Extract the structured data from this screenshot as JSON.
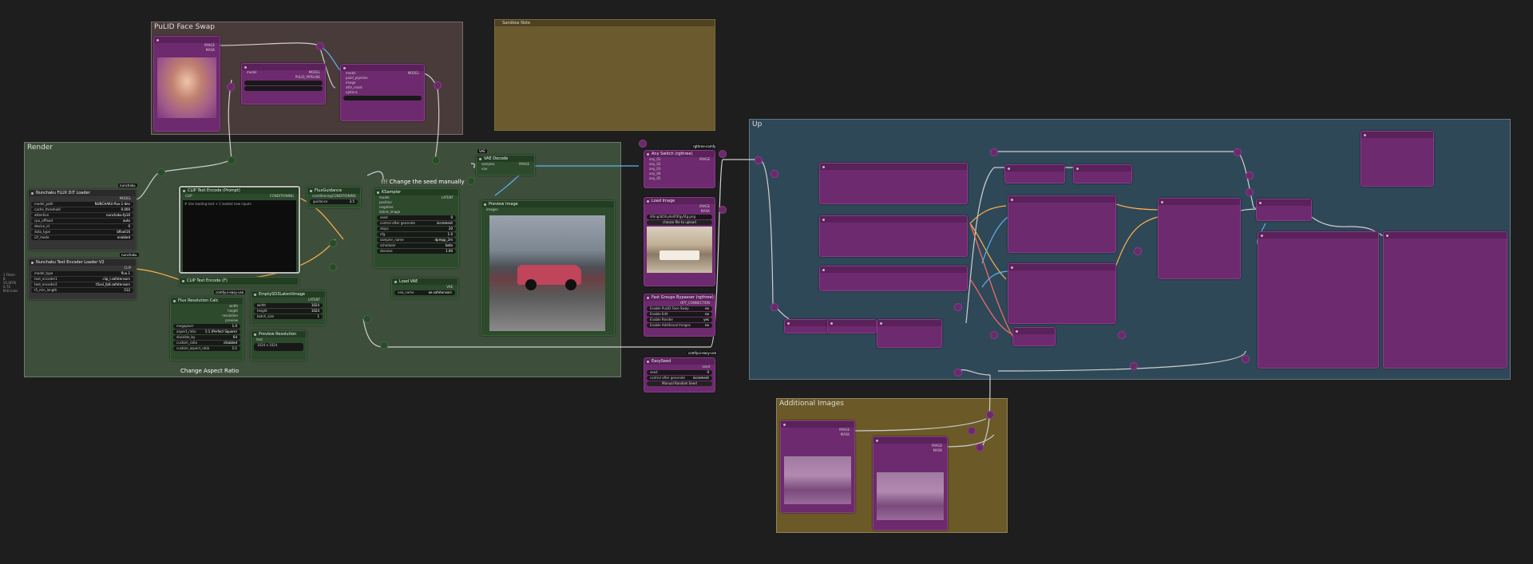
{
  "groups": {
    "pulid": "PuLID Face Swap",
    "render": "Render",
    "upscale": "Up",
    "additional": "Additional Images"
  },
  "notes": {
    "seed_manual": "!!! Change the seed manually",
    "aspect": "Change Aspect Ratio"
  },
  "nodes": {
    "sandbox_note": "Sandbox Note",
    "unet_loader": "Nunchaku FLUX DiT Loader",
    "te_loader": "Nunchaku Text Encoder Loader V2",
    "clip_prompt": "CLIP Text Encode (Prompt)",
    "clip_prompt_placeholder": "# Use loading text + 1 loaded new inputs",
    "clip_negative": "CLIP Text Encode (F)",
    "flux_guidance": "FluxGuidance",
    "ksampler": "KSampler",
    "vae_decode": "VAE Decode",
    "preview_image": "Preview Image",
    "load_vae": "Load VAE",
    "empty_latent": "EmptySD3LatentImage",
    "flux_res": "Flux Resolution Calc",
    "preview_res": "Preview Resolution",
    "any_switch": "Any Switch (rgthree)",
    "load_image": "Load Image",
    "fast_bypasser": "Fast Groups Bypasser (rgthree)",
    "easy_seed": "EasySeed",
    "choose_upload": "choose file to upload",
    "manual_seed": "Manual Random Seed",
    "image_label": "image",
    "text_label": "text"
  },
  "widgets": {
    "unet": [
      {
        "k": "model_path",
        "v": "NUNCHAKU-flux.1-dev"
      },
      {
        "k": "cache_threshold",
        "v": "0.000"
      },
      {
        "k": "attention",
        "v": "nunchaku-fp16"
      },
      {
        "k": "cpu_offload",
        "v": "auto"
      },
      {
        "k": "device_id",
        "v": "0"
      },
      {
        "k": "data_type",
        "v": "bfloat16"
      },
      {
        "k": "i2f_mode",
        "v": "enabled"
      }
    ],
    "te": [
      {
        "k": "model_type",
        "v": "flux.1"
      },
      {
        "k": "text_encoder1",
        "v": "clip_l.safetensors"
      },
      {
        "k": "text_encoder2",
        "v": "t5xxl_fp8.safetensors"
      },
      {
        "k": "t5_min_length",
        "v": "512"
      }
    ],
    "ksampler": [
      {
        "k": "seed",
        "v": "0"
      },
      {
        "k": "control after generate",
        "v": "increment"
      },
      {
        "k": "steps",
        "v": "20"
      },
      {
        "k": "cfg",
        "v": "1.0"
      },
      {
        "k": "sampler_name",
        "v": "dpmpp_2m"
      },
      {
        "k": "scheduler",
        "v": "beta"
      },
      {
        "k": "denoise",
        "v": "1.00"
      }
    ],
    "guidance": [
      {
        "k": "guidance",
        "v": "3.5"
      }
    ],
    "flux_res": [
      {
        "k": "megapixel",
        "v": "1.0"
      },
      {
        "k": "aspect_ratio",
        "v": "1:1 (Perfect Square)"
      },
      {
        "k": "divisible_by",
        "v": "64"
      },
      {
        "k": "custom_ratio",
        "v": "disabled"
      },
      {
        "k": "custom_aspect_ratio",
        "v": "1:1"
      }
    ],
    "empty_latent": [
      {
        "k": "width",
        "v": "1024"
      },
      {
        "k": "height",
        "v": "1024"
      },
      {
        "k": "batch_size",
        "v": "1"
      }
    ],
    "bypasser": [
      {
        "k": "Enable PuLID Face Swap",
        "v": "no"
      },
      {
        "k": "Enable Edit",
        "v": "no"
      },
      {
        "k": "Enable Render",
        "v": "yes"
      },
      {
        "k": "Enable Additional Images",
        "v": "no"
      }
    ],
    "seed": [
      {
        "k": "seed",
        "v": "0"
      },
      {
        "k": "control after generate",
        "v": "increment"
      }
    ],
    "any_switch": [
      "any_01",
      "any_02",
      "any_03",
      "any_04",
      "any_05"
    ],
    "vae_name": "ae.safetensors",
    "load_image_file": "00ing3b5hy4e0f3fgyf4g.png",
    "preview_res_text": "1024 x 1024"
  },
  "tags": {
    "nunchaku": "nunchaku",
    "nunchaku_nodes": "nunchaku-nodes",
    "vae_decode_tag": "VAE",
    "flux_res_tag": "comfyui-easy-use",
    "rgthree": "rgthree-comfy",
    "easy_use": "comfyui-easy-use"
  },
  "slots": {
    "model": "MODEL",
    "clip": "CLIP",
    "conditioning": "CONDITIONING",
    "latent": "LATENT",
    "image": "IMAGE",
    "mask": "MASK",
    "vae": "VAE",
    "positive": "positive",
    "negative": "negative",
    "samples": "samples",
    "latent_image": "latent_image",
    "pulid": "PULID_PIPELINE",
    "images": "images",
    "anything": "anything",
    "output": "output",
    "pixels": "pixels"
  },
  "colors": {
    "canvas": "#1e1e1e",
    "pulid_group": "#4a3b3b",
    "render_group": "#3d4f3b",
    "upscale_group": "#2f4858",
    "additional_group": "#6b5a28",
    "note_bg": "#6b5a2e",
    "node_magenta": "#6e2a6e",
    "node_green": "#2d4a2d"
  },
  "sidebar_info": [
    "1 Fitem",
    "8",
    "55.0FPS",
    "6.7S",
    "N:8 Links"
  ]
}
